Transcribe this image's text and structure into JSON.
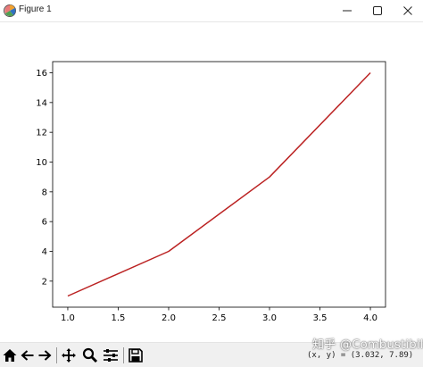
{
  "window": {
    "title": "Figure 1"
  },
  "chart_data": {
    "type": "line",
    "x": [
      1.0,
      2.0,
      3.0,
      4.0
    ],
    "series": [
      {
        "values": [
          1,
          4,
          9,
          16
        ]
      }
    ],
    "xticks": [
      "1.0",
      "1.5",
      "2.0",
      "2.5",
      "3.0",
      "3.5",
      "4.0"
    ],
    "yticks": [
      "2",
      "4",
      "6",
      "8",
      "10",
      "12",
      "14",
      "16"
    ],
    "xlim": [
      0.85,
      4.15
    ],
    "ylim": [
      0.25,
      16.75
    ],
    "title": "",
    "xlabel": "",
    "ylabel": "",
    "grid": false,
    "line_color": "#bb2222"
  },
  "toolbar": {
    "buttons": [
      "home-icon",
      "back-icon",
      "forward-icon",
      "pan-icon",
      "zoom-icon",
      "configure-icon",
      "save-icon"
    ],
    "coords": "(x, y) = (3.032, 7.89)"
  },
  "watermark": {
    "text": "知乎 @Combustibility"
  }
}
